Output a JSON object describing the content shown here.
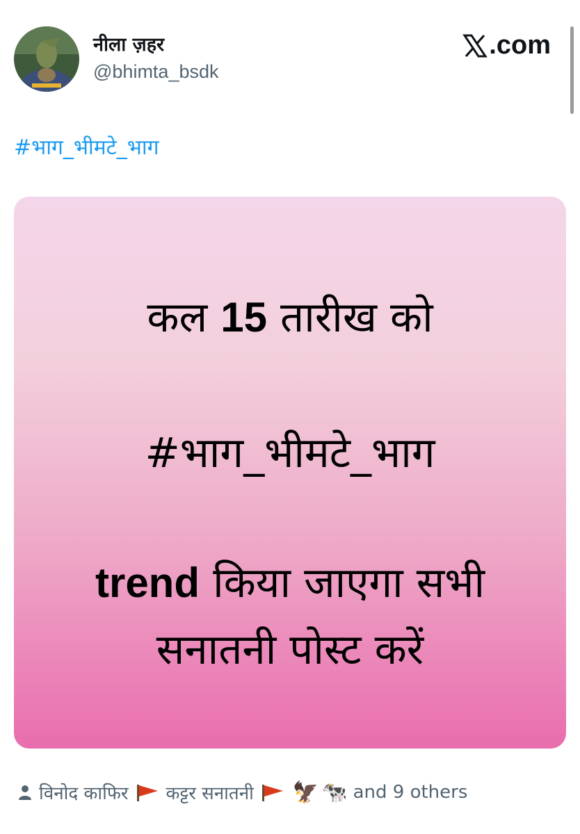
{
  "author": {
    "display_name": "नीला ज़हर",
    "handle": "@bhimta_bsdk"
  },
  "brand": {
    "label": ".com",
    "icon": "x-logo-icon"
  },
  "tweet": {
    "hashtag": "#भाग_भीमटे_भाग"
  },
  "media_text": {
    "line1_prefix": "कल",
    "line1_number": "15",
    "line1_suffix": "तारीख को",
    "line2": "#भाग_भीमटे_भाग",
    "line3_english": "trend",
    "line3_rest": "किया जाएगा सभी",
    "line4": "सनातनी पोस्ट करें"
  },
  "likes_bar": {
    "user1": "विनोद काफिर",
    "user2": "कट्टर सनातनी",
    "emoji_eagle": "🦅",
    "emoji_cow": "🐄",
    "others": "and 9 others",
    "icons": [
      "person-icon",
      "red-flag-icon"
    ]
  },
  "colors": {
    "link": "#1d9bf0",
    "secondary_text": "#536471",
    "flag": "#d93a1c",
    "gradient_top": "#f4d6ea",
    "gradient_bottom": "#e96dae"
  }
}
